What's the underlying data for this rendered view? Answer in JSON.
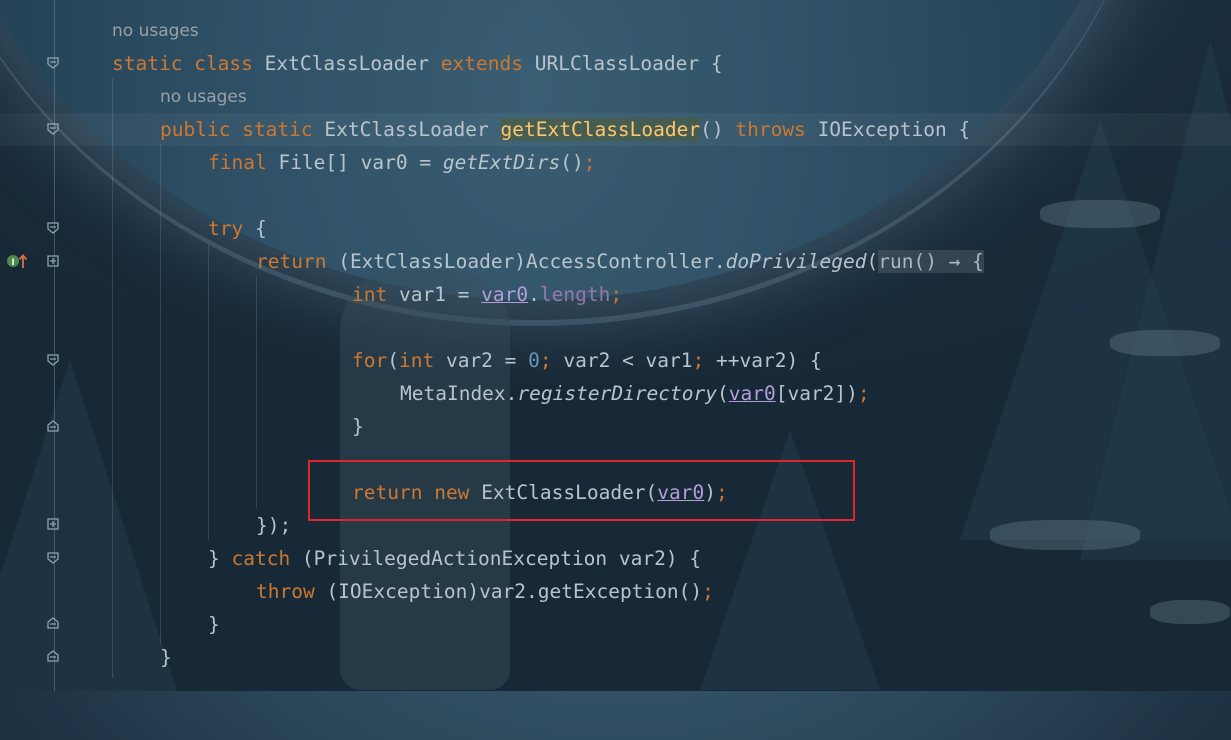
{
  "colors": {
    "keyword": "#cc7832",
    "method_declaration": "#ffc66d",
    "field": "#9876aa",
    "number": "#6897bb",
    "local_var_captured": "#b39ddb",
    "plain": "#b8c4cc",
    "hint": "#97a2a9",
    "highlight_box": "#e0262b"
  },
  "hints": {
    "class_usages": "no usages",
    "method_usages": "no usages"
  },
  "code": {
    "l1": {
      "kw1": "static",
      "kw2": "class",
      "name": "ExtClassLoader",
      "kw3": "extends",
      "super": "URLClassLoader",
      "brace": "{"
    },
    "l2": {
      "kw1": "public",
      "kw2": "static",
      "type": "ExtClassLoader",
      "method": "getExtClassLoader",
      "parens": "()",
      "kw3": "throws",
      "exc": "IOException",
      "brace": "{"
    },
    "l3": {
      "kw": "final",
      "type": "File[] var0 = ",
      "call": "getExtDirs",
      "tail": "()",
      "semi": ";"
    },
    "l4": {
      "kw": "try",
      "brace": "{"
    },
    "l5": {
      "kw": "return",
      "cast": "(ExtClassLoader)AccessController.",
      "call": "doPrivileged",
      "open": "(",
      "fold": "run() → {"
    },
    "l6": {
      "kw": "int",
      "decl": "var1 = ",
      "var": "var0",
      "dot": ".",
      "field": "length",
      "semi": ";"
    },
    "l7": {
      "kw": "for",
      "open": "(",
      "kw2": "int",
      "decl": " var2 = ",
      "num": "0",
      "semi1": ";",
      "cond": " var2 < var1",
      "semi2": ";",
      "inc": " ++var2) {"
    },
    "l8": {
      "cls": "MetaIndex.",
      "call": "registerDirectory",
      "open": "(",
      "var": "var0",
      "idx": "[var2])",
      "semi": ";"
    },
    "l9": {
      "brace": "}"
    },
    "l10": {
      "kw1": "return",
      "kw2": "new",
      "type": "ExtClassLoader(",
      "var": "var0",
      "close": ")",
      "semi": ";"
    },
    "l11": {
      "text": "});"
    },
    "l12": {
      "brace": "} ",
      "kw": "catch",
      "rest": " (PrivilegedActionException var2) {"
    },
    "l13": {
      "kw": "throw",
      "rest": " (IOException)var2.getException()",
      "semi": ";"
    },
    "l14": {
      "brace": "}"
    },
    "l15": {
      "brace": "}"
    }
  },
  "gutter": {
    "override_icon": "implements-method-icon"
  }
}
